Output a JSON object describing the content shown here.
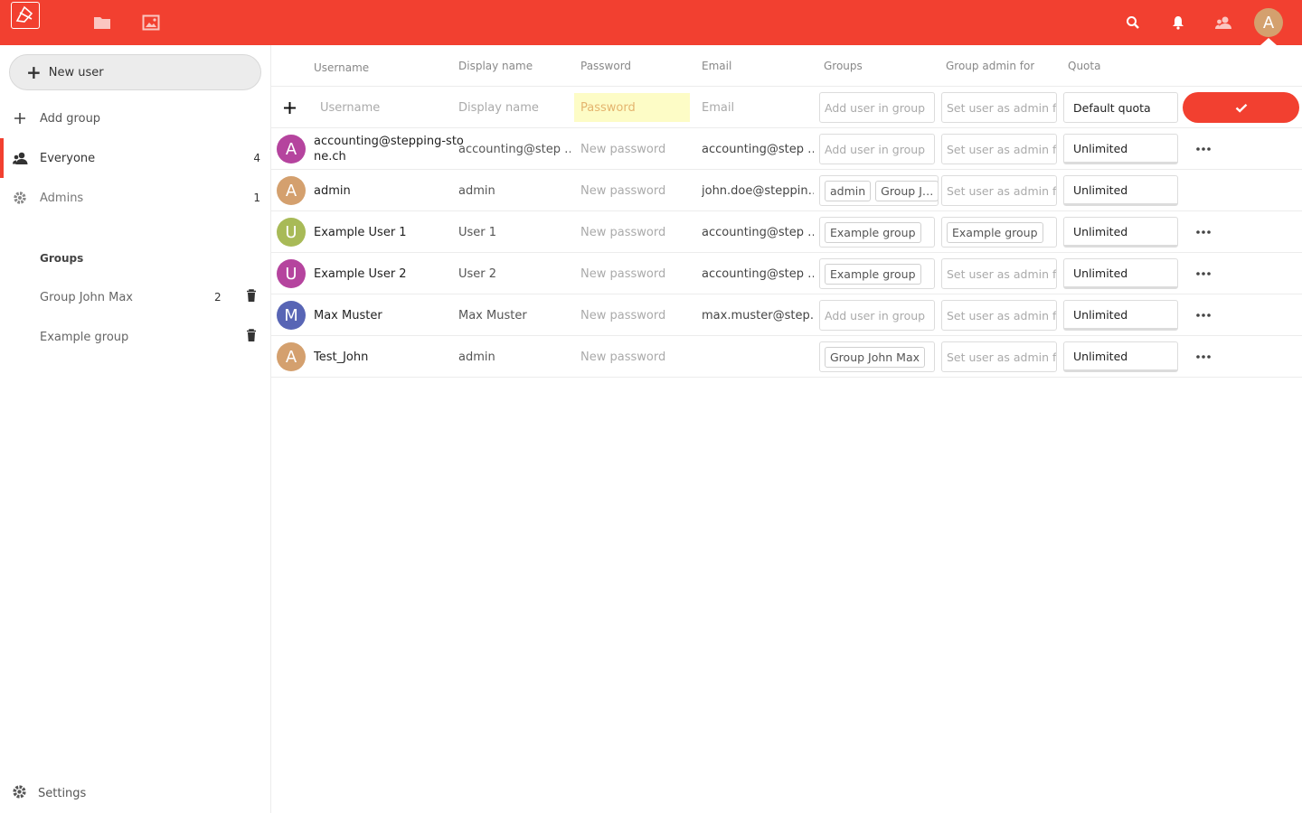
{
  "colors": {
    "accent": "#f24030",
    "avatar_a": "#b5449e",
    "avatar_admin": "#d4a06e",
    "avatar_u": "#a8ba57",
    "avatar_u2": "#b5449e",
    "avatar_m": "#5865b5"
  },
  "header": {
    "avatar_letter": "A",
    "icons": [
      "files-icon",
      "photos-icon",
      "search-icon",
      "notifications-icon",
      "contacts-icon"
    ]
  },
  "sidebar": {
    "new_user_label": "New user",
    "add_group_label": "Add group",
    "everyone": {
      "label": "Everyone",
      "count": "4"
    },
    "admins": {
      "label": "Admins",
      "count": "1"
    },
    "groups_heading": "Groups",
    "groups": [
      {
        "label": "Group John Max",
        "count": "2"
      },
      {
        "label": "Example group",
        "count": ""
      }
    ],
    "settings_label": "Settings"
  },
  "table": {
    "headers": {
      "username": "Username",
      "display_name": "Display name",
      "password": "Password",
      "email": "Email",
      "groups": "Groups",
      "group_admin": "Group admin for",
      "quota": "Quota"
    },
    "new_row": {
      "username_placeholder": "Username",
      "display_placeholder": "Display name",
      "password_placeholder": "Password",
      "email_placeholder": "Email",
      "groups_placeholder": "Add user in group",
      "admin_placeholder": "Set user as admin for",
      "quota": "Default quota"
    },
    "password_placeholder": "New password",
    "groups_placeholder": "Add user in group",
    "admin_placeholder": "Set user as admin for",
    "rows": [
      {
        "avatar": "A",
        "username": "accounting@stepping-stone.ch",
        "username_line1": "accounting@stepping-sto",
        "username_line2": "ne.ch",
        "display": "accounting@step  …",
        "email": "accounting@step  …",
        "groups": [],
        "admin_for": [],
        "quota": "Unlimited",
        "has_menu": true
      },
      {
        "avatar": "A",
        "username": "admin",
        "display": "admin",
        "email": "john.doe@steppin…",
        "groups": [
          "admin",
          "Group J…"
        ],
        "admin_for": [],
        "quota": "Unlimited",
        "has_menu": false
      },
      {
        "avatar": "U",
        "username": "Example User 1",
        "display": "User 1",
        "email": "accounting@step  …",
        "groups": [
          "Example group"
        ],
        "admin_for": [
          "Example group"
        ],
        "quota": "Unlimited",
        "has_menu": true
      },
      {
        "avatar": "U",
        "username": "Example User 2",
        "display": "User 2",
        "email": "accounting@step  …",
        "groups": [
          "Example group"
        ],
        "admin_for": [],
        "quota": "Unlimited",
        "has_menu": true
      },
      {
        "avatar": "M",
        "username": "Max Muster",
        "display": "Max Muster",
        "email": "max.muster@step…",
        "groups": [],
        "admin_for": [],
        "quota": "Unlimited",
        "has_menu": true
      },
      {
        "avatar": "A",
        "username": "Test_John",
        "display": "admin",
        "email": "",
        "groups": [
          "Group John Max"
        ],
        "admin_for": [],
        "quota": "Unlimited",
        "has_menu": true
      }
    ]
  }
}
